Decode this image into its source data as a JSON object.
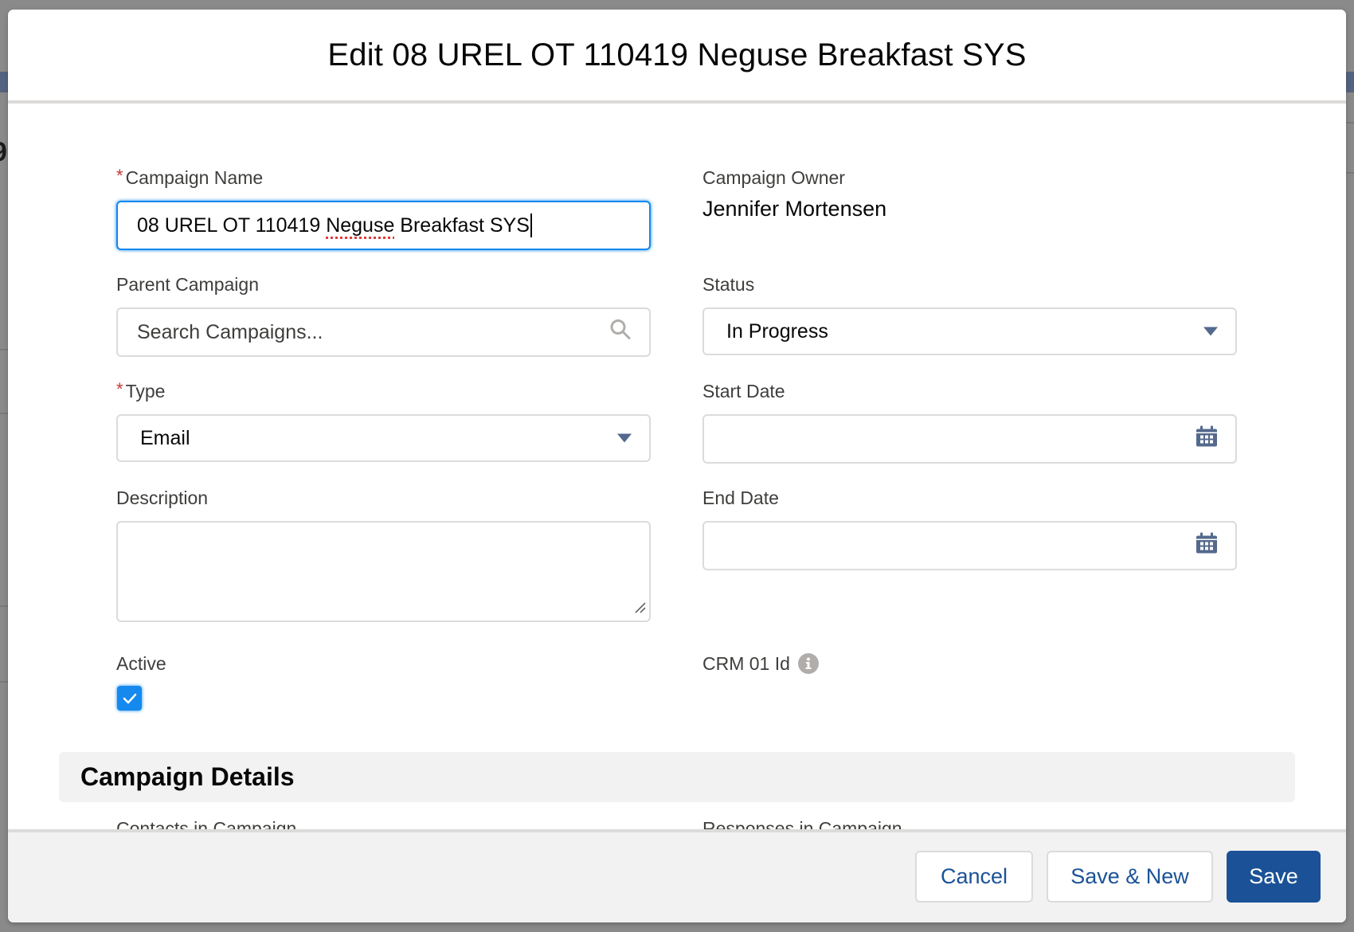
{
  "modal": {
    "title": "Edit 08 UREL OT 110419 Neguse Breakfast SYS"
  },
  "form": {
    "campaign_name": {
      "label": "Campaign Name",
      "required_marker": "*",
      "value_prefix": "08 UREL OT 110419 ",
      "value_misspelled": "Neguse",
      "value_suffix": " Breakfast SYS"
    },
    "campaign_owner": {
      "label": "Campaign Owner",
      "value": "Jennifer Mortensen"
    },
    "parent_campaign": {
      "label": "Parent Campaign",
      "placeholder": "Search Campaigns...",
      "icon": "search-icon"
    },
    "status": {
      "label": "Status",
      "value": "In Progress",
      "icon": "chevron-down-icon"
    },
    "type": {
      "label": "Type",
      "required_marker": "*",
      "value": "Email",
      "icon": "chevron-down-icon"
    },
    "start_date": {
      "label": "Start Date",
      "value": "",
      "icon": "calendar-icon"
    },
    "description": {
      "label": "Description",
      "value": ""
    },
    "end_date": {
      "label": "End Date",
      "value": "",
      "icon": "calendar-icon"
    },
    "active": {
      "label": "Active",
      "checked": true
    },
    "crm_id": {
      "label": "CRM 01 Id",
      "icon": "info-icon"
    }
  },
  "section": {
    "title": "Campaign Details",
    "fields": [
      {
        "label": "Contacts in Campaign"
      },
      {
        "label": "Responses in Campaign"
      }
    ]
  },
  "footer": {
    "cancel_label": "Cancel",
    "save_new_label": "Save & New",
    "save_label": "Save"
  },
  "colors": {
    "brand": "#1b5297",
    "focus": "#1589ee",
    "required": "#c23934",
    "icon": "#54698d"
  }
}
